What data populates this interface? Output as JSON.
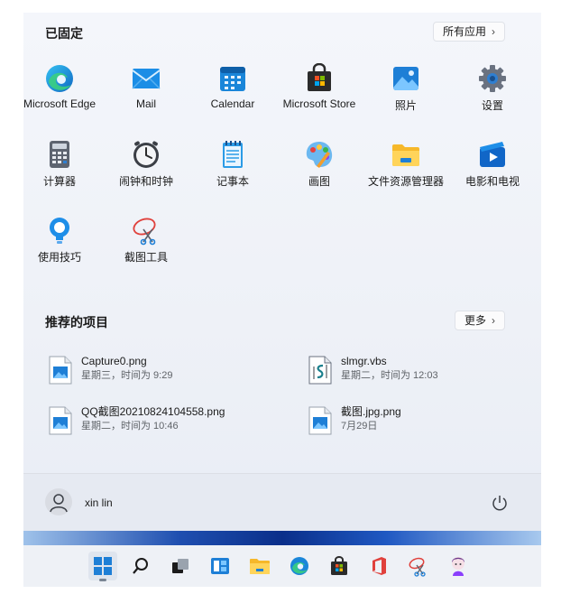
{
  "pinned": {
    "title": "已固定",
    "all_apps_label": "所有应用",
    "apps": [
      {
        "label": "Microsoft Edge",
        "icon": "edge-icon"
      },
      {
        "label": "Mail",
        "icon": "mail-icon"
      },
      {
        "label": "Calendar",
        "icon": "calendar-icon"
      },
      {
        "label": "Microsoft Store",
        "icon": "store-icon"
      },
      {
        "label": "照片",
        "icon": "photos-icon"
      },
      {
        "label": "设置",
        "icon": "settings-icon"
      },
      {
        "label": "计算器",
        "icon": "calculator-icon"
      },
      {
        "label": "闹钟和时钟",
        "icon": "clock-icon"
      },
      {
        "label": "记事本",
        "icon": "notepad-icon"
      },
      {
        "label": "画图",
        "icon": "paint-icon"
      },
      {
        "label": "文件资源管理器",
        "icon": "folder-icon"
      },
      {
        "label": "电影和电视",
        "icon": "movies-icon"
      },
      {
        "label": "使用技巧",
        "icon": "tips-icon"
      },
      {
        "label": "截图工具",
        "icon": "snipping-tool-icon"
      }
    ]
  },
  "recommended": {
    "title": "推荐的项目",
    "more_label": "更多",
    "items": [
      {
        "name": "Capture0.png",
        "meta": "星期三，时间为 9:29",
        "icon": "image-file-icon"
      },
      {
        "name": "slmgr.vbs",
        "meta": "星期二，时间为 12:03",
        "icon": "script-file-icon"
      },
      {
        "name": "QQ截图20210824104558.png",
        "meta": "星期二，时间为 10:46",
        "icon": "image-file-icon"
      },
      {
        "name": "截图.jpg.png",
        "meta": "7月29日",
        "icon": "image-file-icon"
      }
    ]
  },
  "user": {
    "name": "xin lin"
  },
  "taskbar": {
    "items": [
      "start-icon",
      "search-icon",
      "task-view-icon",
      "widgets-icon",
      "file-explorer-icon",
      "edge-icon",
      "store-icon",
      "office-icon",
      "snipping-tool-icon",
      "app-avatar-icon"
    ]
  },
  "colors": {
    "accent": "#0067c0",
    "panel": "#f3f5fa"
  }
}
